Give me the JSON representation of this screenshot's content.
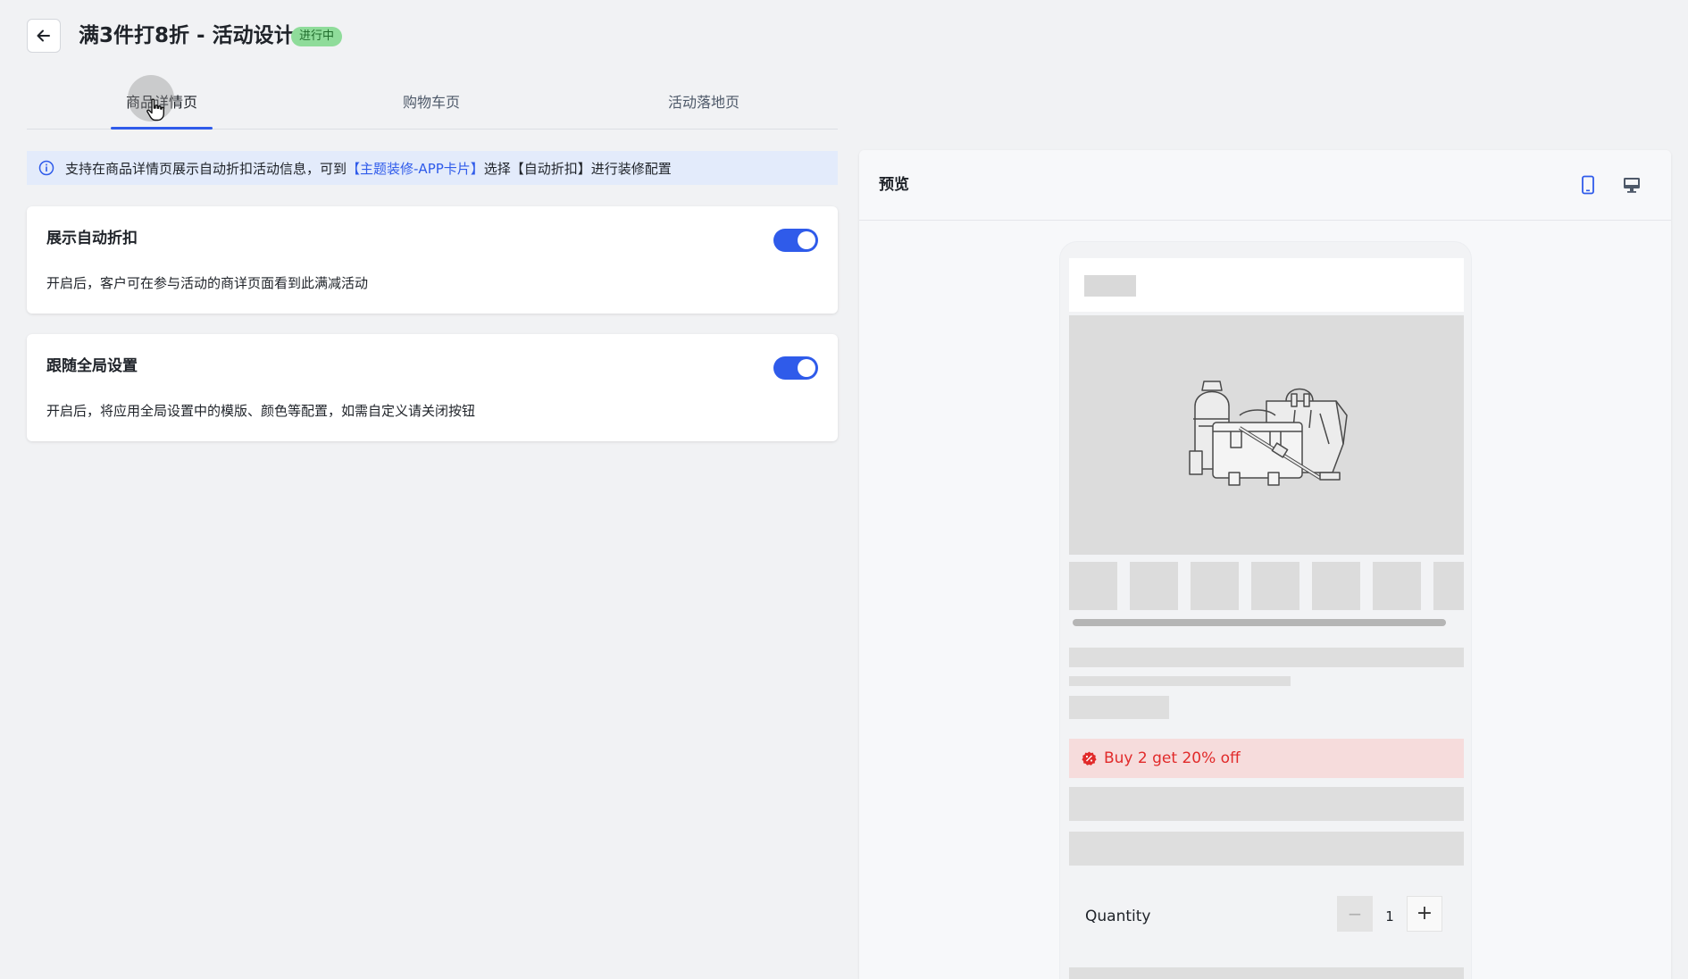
{
  "header": {
    "title": "满3件打8折 - 活动设计",
    "status_badge": "进行中",
    "back_icon": "arrow-left-icon"
  },
  "tabs": [
    {
      "label": "商品详情页",
      "active": true
    },
    {
      "label": "购物车页",
      "active": false
    },
    {
      "label": "活动落地页",
      "active": false
    }
  ],
  "info_bar": {
    "text_before": "支持在商品详情页展示自动折扣活动信息，可到",
    "link_text": "【主题装修-APP卡片】",
    "text_after": "选择【自动折扣】进行装修配置"
  },
  "settings": [
    {
      "title": "展示自动折扣",
      "description": "开启后，客户可在参与活动的商详页面看到此满减活动",
      "enabled": true
    },
    {
      "title": "跟随全局设置",
      "description": "开启后，将应用全局设置中的模版、颜色等配置，如需自定义请关闭按钮",
      "enabled": true
    }
  ],
  "preview": {
    "title": "预览",
    "devices": [
      "mobile-icon",
      "desktop-icon"
    ],
    "active_device": "mobile",
    "discount_text": "Buy 2 get 20% off",
    "quantity_label": "Quantity",
    "quantity_value": "1",
    "minus_symbol": "−",
    "plus_symbol": "+"
  },
  "colors": {
    "accent": "#2f5bea",
    "badge_bg": "#8fdc9a",
    "discount_text": "#e12a2a",
    "discount_bg": "#f6dcdc",
    "info_bg": "#e3ebfb"
  }
}
